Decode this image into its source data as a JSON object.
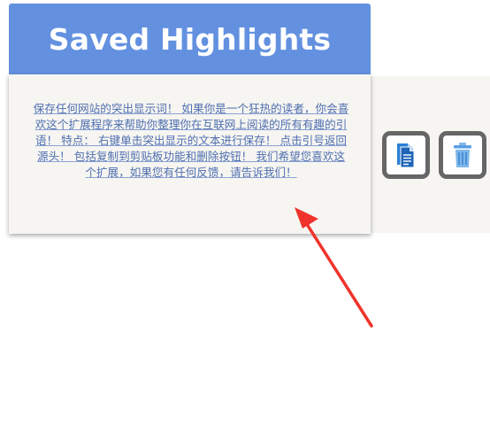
{
  "header": {
    "title": "Saved Highlights"
  },
  "highlight": {
    "text": "保存任何网站的突出显示词！ 如果你是一个狂热的读者，你会喜欢这个扩展程序来帮助你整理你在互联网上阅读的所有有趣的引语！ 特点： 右键单击突出显示的文本进行保存！ 点击引号返回源头！ 包括复制到剪贴板功能和删除按钮！ 我们希望您喜欢这个扩展，如果您有任何反馈，请告诉我们！"
  },
  "actions": {
    "copy_icon": "copy-document-icon",
    "delete_icon": "trash-icon"
  },
  "annotation": {
    "arrow_color": "#f0332b"
  },
  "colors": {
    "header_bg": "#6391e0",
    "card_bg": "#f6f5f1",
    "link_text": "#4f6fb0",
    "icon_blue": "#2a7fd6",
    "icon_border": "#666666"
  }
}
